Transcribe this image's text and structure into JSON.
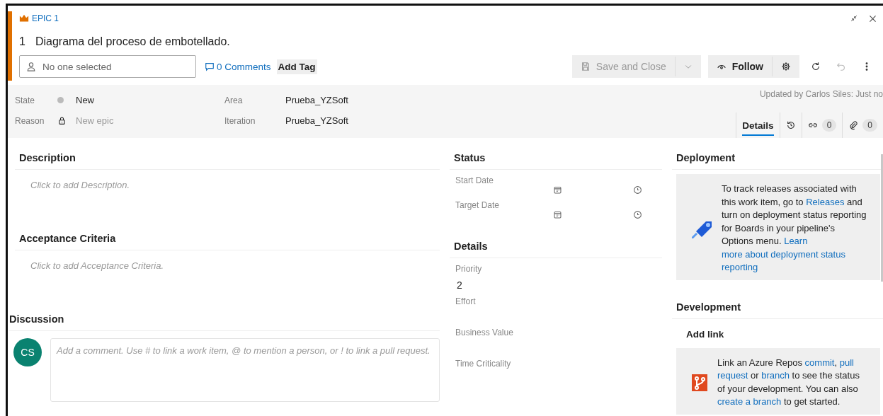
{
  "header": {
    "type_label": "EPIC 1",
    "id": "1",
    "title": "Diagrama del proceso de embotellado.",
    "assignee": {
      "placeholder": "No one selected"
    },
    "comments": "0 Comments",
    "add_tag": "Add Tag"
  },
  "toolbar": {
    "save": {
      "label": "Save and Close",
      "disabled": true
    },
    "follow": "Follow",
    "undo": {
      "disabled": true
    }
  },
  "state_fields": [
    {
      "kind": "state",
      "label": "State",
      "value": "New"
    },
    {
      "kind": "locked",
      "label": "Reason",
      "value": "New epic"
    }
  ],
  "path_fields": [
    {
      "label": "Area",
      "value": "Prueba_YZSoft"
    },
    {
      "label": "Iteration",
      "value": "Prueba_YZSoft"
    }
  ],
  "updated": "Updated by Carlos Siles: Just no",
  "tabs": [
    {
      "kind": "details",
      "label": "Details",
      "selected": true
    },
    {
      "kind": "history",
      "selected": false
    },
    {
      "kind": "links",
      "count": "0",
      "selected": false
    },
    {
      "kind": "attachments",
      "count": "0",
      "selected": false
    }
  ],
  "description": {
    "heading": "Description",
    "placeholder": "Click to add Description."
  },
  "acceptance": {
    "heading": "Acceptance Criteria",
    "placeholder": "Click to add Acceptance Criteria."
  },
  "discussion": {
    "heading": "Discussion",
    "avatar": "CS",
    "placeholder": "Add a comment. Use # to link a work item, @ to mention a person, or ! to link a pull request."
  },
  "status": {
    "heading": "Status",
    "dates": [
      {
        "label": "Start Date"
      },
      {
        "label": "Target Date"
      }
    ]
  },
  "details": {
    "heading": "Details",
    "fields": [
      {
        "label": "Priority",
        "value": "2"
      },
      {
        "label": "Effort"
      },
      {
        "label": "Business Value"
      },
      {
        "label": "Time Criticality"
      }
    ]
  },
  "deployment": {
    "heading": "Deployment",
    "text": [
      {
        "kind": "text",
        "text": "To track releases associated with this work item, go to "
      },
      {
        "kind": "link",
        "text": "Releases"
      },
      {
        "kind": "text",
        "text": " and turn on deployment status reporting for Boards in your pipeline's Options menu. "
      },
      {
        "kind": "link",
        "text": "Learn"
      },
      {
        "kind": "link",
        "text": "more about deployment status"
      },
      {
        "kind": "link",
        "text": "reporting"
      }
    ]
  },
  "development": {
    "heading": "Development",
    "add_link": "Add link",
    "text": [
      {
        "kind": "text",
        "text": "Link an Azure Repos "
      },
      {
        "kind": "link",
        "text": "commit"
      },
      {
        "kind": "text",
        "text": ", "
      },
      {
        "kind": "link",
        "text": "pull"
      },
      {
        "kind": "link",
        "text": "request"
      },
      {
        "kind": "text",
        "text": " or "
      },
      {
        "kind": "link",
        "text": "branch"
      },
      {
        "kind": "text",
        "text": " to see the status of your development. You can also "
      },
      {
        "kind": "link",
        "text": "create a branch"
      },
      {
        "kind": "text",
        "text": " to get started."
      }
    ]
  }
}
